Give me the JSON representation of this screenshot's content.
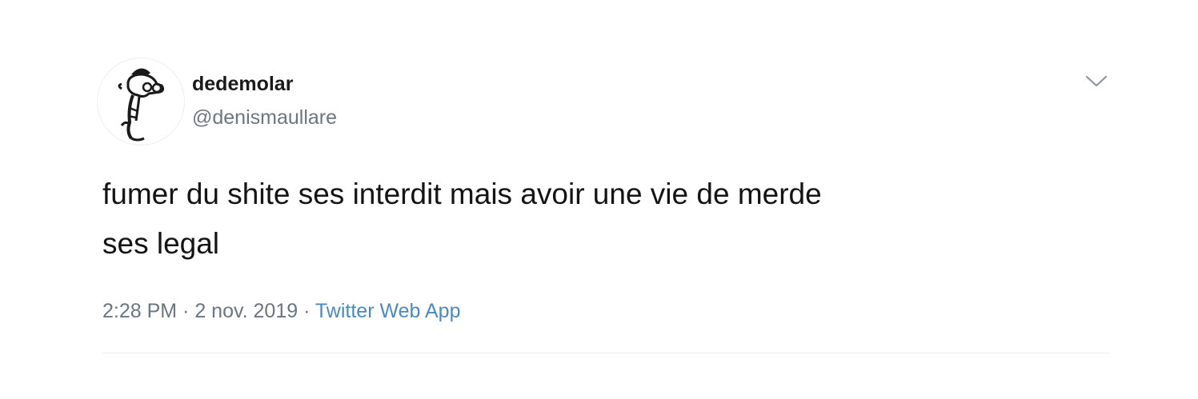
{
  "tweet": {
    "avatar_icon": "cartoon-character-avatar-icon",
    "display_name": "dedemolar",
    "handle": "@denismaullare",
    "caret_icon": "chevron-down-icon",
    "text_line1": "fumer du shite ses interdit mais avoir une vie de merde",
    "text_line2": "ses legal",
    "time": "2:28 PM",
    "separator1": " · ",
    "date": "2 nov. 2019",
    "separator2": " · ",
    "source": "Twitter Web App"
  },
  "colors": {
    "text": "#141414",
    "secondary": "#6a7680",
    "link": "#4a8ac4",
    "divider": "#ececec"
  }
}
